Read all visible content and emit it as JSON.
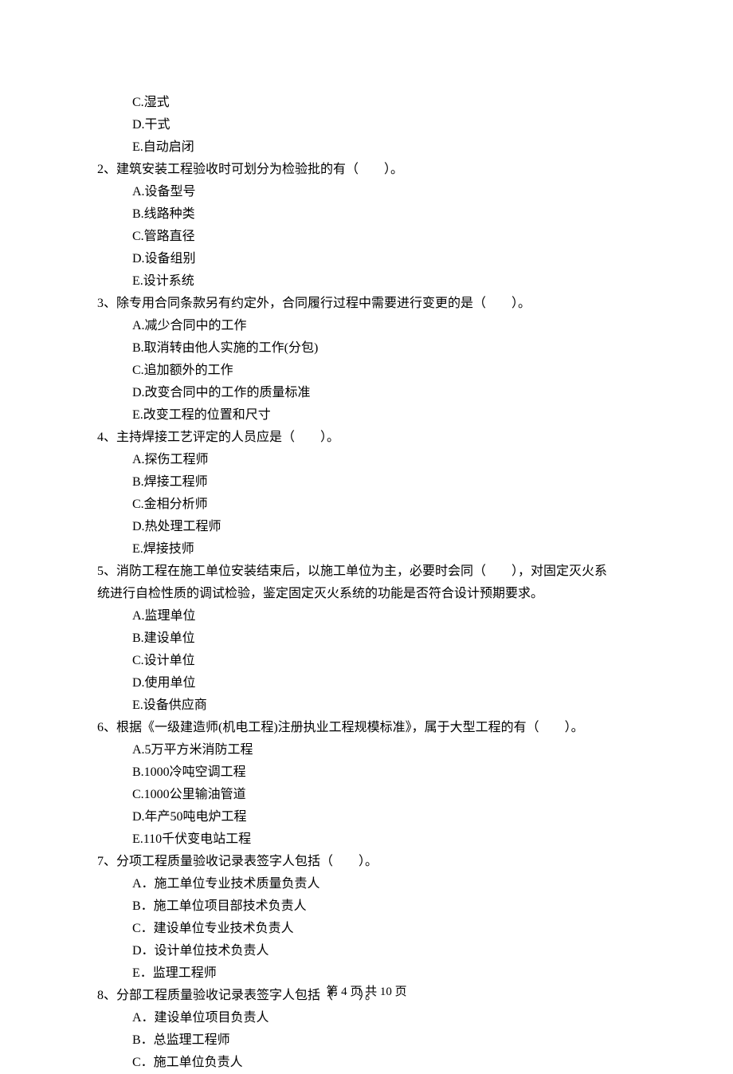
{
  "prev_options": {
    "C": "C.湿式",
    "D": "D.干式",
    "E": "E.自动启闭"
  },
  "questions": [
    {
      "stem": "2、建筑安装工程验收时可划分为检验批的有（　　）。",
      "options": [
        "A.设备型号",
        "B.线路种类",
        "C.管路直径",
        "D.设备组别",
        "E.设计系统"
      ]
    },
    {
      "stem": "3、除专用合同条款另有约定外，合同履行过程中需要进行变更的是（　　）。",
      "options": [
        "A.减少合同中的工作",
        "B.取消转由他人实施的工作(分包)",
        "C.追加额外的工作",
        "D.改变合同中的工作的质量标准",
        "E.改变工程的位置和尺寸"
      ]
    },
    {
      "stem": "4、主持焊接工艺评定的人员应是（　　）。",
      "options": [
        "A.探伤工程师",
        "B.焊接工程师",
        "C.金相分析师",
        "D.热处理工程师",
        "E.焊接技师"
      ]
    },
    {
      "stem": "5、消防工程在施工单位安装结束后，以施工单位为主，必要时会同（　　），对固定灭火系",
      "stem_cont": "统进行自检性质的调试检验，鉴定固定灭火系统的功能是否符合设计预期要求。",
      "options": [
        "A.监理单位",
        "B.建设单位",
        "C.设计单位",
        "D.使用单位",
        "E.设备供应商"
      ]
    },
    {
      "stem": "6、根据《一级建造师(机电工程)注册执业工程规模标准》，属于大型工程的有（　　）。",
      "options": [
        "A.5万平方米消防工程",
        "B.1000冷吨空调工程",
        "C.1000公里输油管道",
        "D.年产50吨电炉工程",
        "E.110千伏变电站工程"
      ]
    },
    {
      "stem": "7、分项工程质量验收记录表签字人包括（　　）。",
      "options": [
        "A．施工单位专业技术质量负责人",
        "B．施工单位项目部技术负责人",
        "C．建设单位专业技术负责人",
        "D．设计单位技术负责人",
        "E．监理工程师"
      ]
    },
    {
      "stem": "8、分部工程质量验收记录表签字人包括（　　）。",
      "options": [
        "A．建设单位项目负责人",
        "B．总监理工程师",
        "C．施工单位负责人"
      ]
    }
  ],
  "footer": "第 4 页 共 10 页"
}
